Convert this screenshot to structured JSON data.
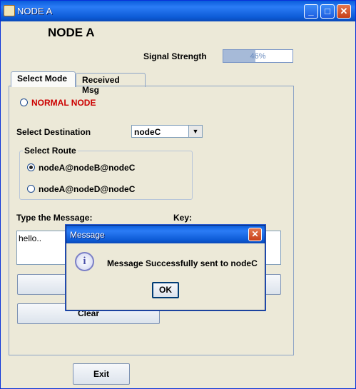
{
  "window": {
    "title": "NODE A"
  },
  "header": {
    "heading": "NODE A"
  },
  "signal": {
    "label": "Signal Strength",
    "value_text": "46%",
    "value": 0.46
  },
  "tabs": [
    {
      "label": "Select Mode"
    },
    {
      "label": "Received Msg"
    }
  ],
  "mode": {
    "normal_node_label": "NORMAL NODE"
  },
  "destination": {
    "label": "Select Destination",
    "selected": "nodeC"
  },
  "route": {
    "legend": "Select Route",
    "options": [
      {
        "label": "nodeA@nodeB@nodeC"
      },
      {
        "label": "nodeA@nodeD@nodeC"
      }
    ]
  },
  "message": {
    "label": "Type the Message:",
    "key_label": "Key:",
    "text": "hello.."
  },
  "buttons": {
    "clear": "Clear",
    "exit": "Exit"
  },
  "dialog": {
    "title": "Message",
    "text": "Message Successfully sent to nodeC",
    "ok": "OK"
  },
  "colors": {
    "accent": "#0A5DDB",
    "normal_node": "#CC0000"
  }
}
